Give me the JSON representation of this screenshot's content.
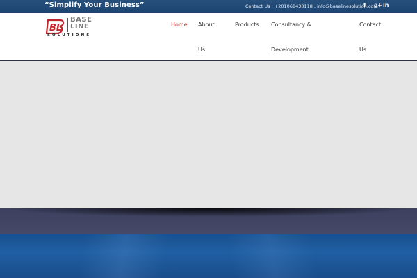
{
  "topbar": {
    "tagline": "“Simplify Your Business”",
    "contact_text": "Contact Us : +201068430118 , info@baselinesolution.com",
    "social": {
      "facebook": {
        "icon": "facebook-icon",
        "glyph": "f"
      },
      "googleplus": {
        "icon": "google-plus-icon",
        "glyph": "g+"
      },
      "linkedin": {
        "icon": "linkedin-icon",
        "glyph": "in"
      }
    }
  },
  "logo": {
    "mark": "BL",
    "line1": "BASE",
    "line2": "LINE",
    "line3": "SOLUTIONS"
  },
  "nav": {
    "home": "Home",
    "about_1": "About",
    "about_2": "Us",
    "products": "Products",
    "consultancy_1": "Consultancy &",
    "consultancy_2": "Development",
    "contact_1": "Contact",
    "contact_2": "Us",
    "active": "Home"
  },
  "colors": {
    "topbar": "#1f4673",
    "accent_red": "#c0262d",
    "nav_text": "#333333",
    "slider_bg": "#e6e6e6",
    "band": "#414563",
    "hero_blue": "#1d5799"
  }
}
